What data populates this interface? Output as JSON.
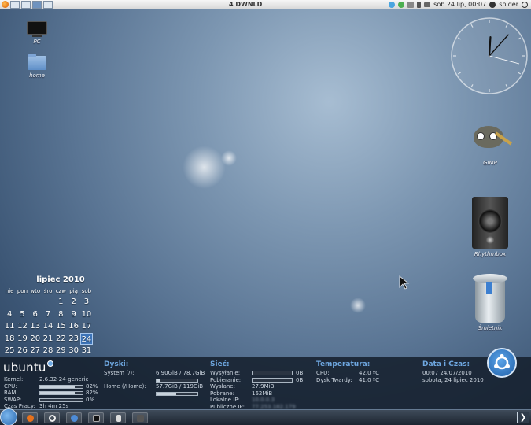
{
  "top_panel": {
    "title": "4 DWNLD",
    "datetime": "sob 24 lip, 00:07",
    "user": "spider",
    "icons": [
      "firefox-icon",
      "workspace-1",
      "workspace-2",
      "workspace-3",
      "workspace-4",
      "network-icon",
      "chat-icon",
      "volume-icon",
      "battery-icon",
      "mail-icon",
      "power-icon"
    ]
  },
  "desktop": {
    "icons": [
      {
        "label": "PC",
        "icon": "computer-icon"
      },
      {
        "label": "home",
        "icon": "home-folder-icon"
      },
      {
        "label": "GIMP",
        "icon": "gimp-icon"
      },
      {
        "label": "Rhythmbox",
        "icon": "rhythmbox-icon"
      },
      {
        "label": "Śmietnik",
        "icon": "trash-icon"
      }
    ]
  },
  "clock": {
    "hour": 0,
    "minute": 7
  },
  "calendar": {
    "title": "lipiec 2010",
    "weekdays": [
      "nie",
      "pon",
      "wto",
      "śro",
      "czw",
      "pią",
      "sob"
    ],
    "first_weekday_index": 4,
    "days_in_month": 31,
    "today": 24
  },
  "conky": {
    "brand": "ubuntu",
    "system": {
      "kernel_label": "Kernel:",
      "kernel": "2.6.32-24-generic",
      "cpu_label": "CPU:",
      "cpu": "82%",
      "cpu_value": 82,
      "ram_label": "RAM:",
      "ram": "82%",
      "ram_value": 82,
      "swap_label": "SWAP:",
      "swap": "0%",
      "swap_value": 0,
      "uptime_label": "Czas Pracy:",
      "uptime": "3h 4m 25s"
    },
    "disks": {
      "title": "Dyski:",
      "system_label": "System (/):",
      "system": "6.90GiB / 78.7GiB",
      "system_fraction": 0.088,
      "home_label": "Home (/Home):",
      "home": "57.7GiB / 119GiB",
      "home_fraction": 0.485
    },
    "network": {
      "title": "Sieć:",
      "up_label": "Wysyłanie:",
      "up": "0B",
      "down_label": "Pobieranie:",
      "down": "0B",
      "sent_label": "Wysłane:",
      "sent": "27.9MiB",
      "recv_label": "Pobrane:",
      "recv": "162MiB",
      "local_ip_label": "Lokalne IP:",
      "local_ip": "10.0.0.3",
      "public_ip_label": "Publiczne IP:",
      "public_ip": "77.253.182.179"
    },
    "temperature": {
      "title": "Temperatura:",
      "cpu_label": "CPU:",
      "cpu": "42.0 ºC",
      "disk_label": "Dysk Twardy:",
      "disk": "41.0 ºC"
    },
    "datetime": {
      "title": "Data i Czas:",
      "line1": "00:07  24/07/2010",
      "line2": "sobota, 24 lipiec 2010"
    }
  },
  "bottom_panel": {
    "show_desktop": "❯",
    "tasks": [
      "firefox-task-icon",
      "opera-task-icon",
      "thunderbird-task-icon",
      "terminal-task-icon",
      "battery-task-icon",
      "files-task-icon"
    ]
  },
  "colors": {
    "accent": "#6ea7e0",
    "panel_bg": "#1c2430"
  }
}
